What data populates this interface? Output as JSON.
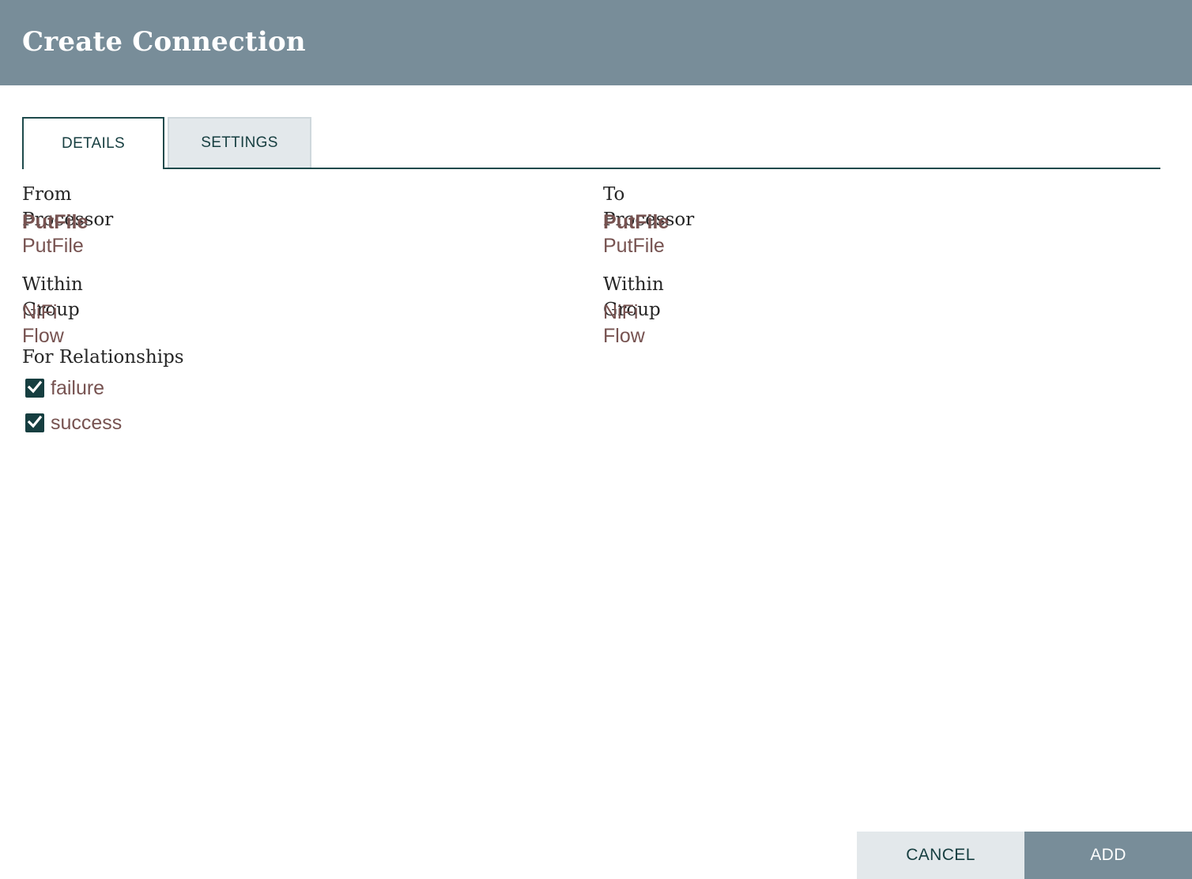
{
  "dialog": {
    "title": "Create Connection"
  },
  "tabs": [
    {
      "label": "DETAILS",
      "active": true
    },
    {
      "label": "SETTINGS",
      "active": false
    }
  ],
  "details": {
    "from": {
      "heading": "From Processor",
      "name": "PutFile",
      "type": "PutFile",
      "group_heading": "Within Group",
      "group": "NiFi Flow"
    },
    "to": {
      "heading": "To Processor",
      "name": "PutFile",
      "type": "PutFile",
      "group_heading": "Within Group",
      "group": "NiFi Flow"
    },
    "relationships_heading": "For Relationships",
    "relationships": [
      {
        "label": "failure",
        "checked": true
      },
      {
        "label": "success",
        "checked": true
      }
    ]
  },
  "footer": {
    "cancel_label": "CANCEL",
    "add_label": "ADD"
  },
  "colors": {
    "header_bg": "#788d99",
    "accent_dark": "#163e40",
    "value_text": "#775351",
    "secondary_button_bg": "#e3e8eb"
  }
}
